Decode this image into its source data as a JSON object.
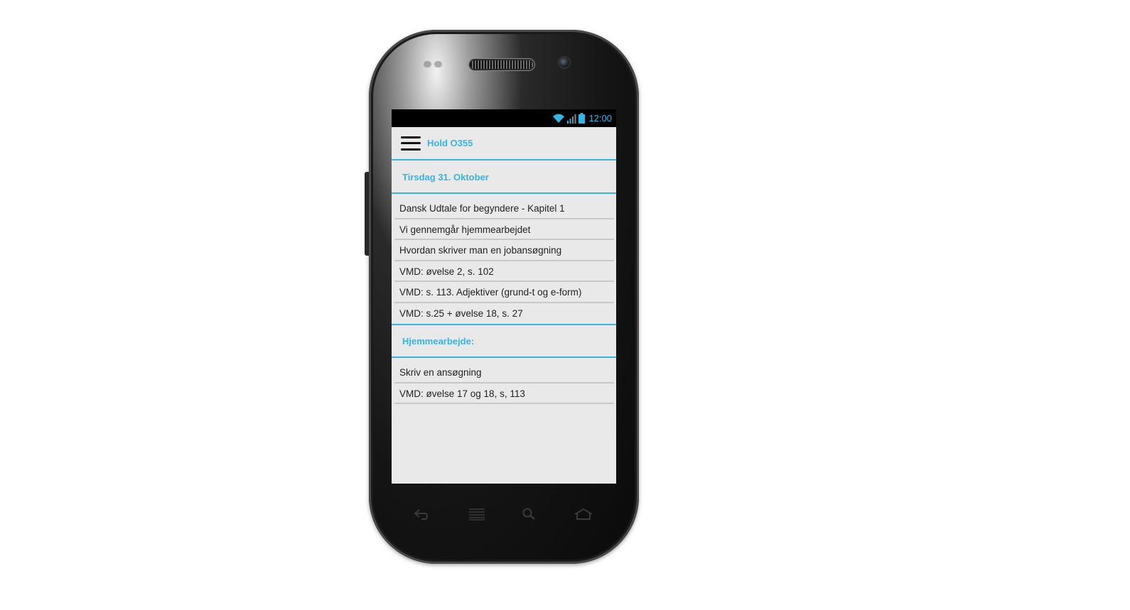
{
  "status": {
    "time": "12:00"
  },
  "header": {
    "title": "Hold O355"
  },
  "date_section": {
    "title": "Tirsdag 31. Oktober"
  },
  "lessons": [
    "Dansk Udtale for begyndere - Kapitel 1",
    "Vi gennemgår hjemmearbejdet",
    "Hvordan skriver man en jobansøgning",
    "VMD: øvelse 2, s. 102",
    "VMD: s. 113. Adjektiver (grund-t og e-form)",
    "VMD: s.25 + øvelse 18, s. 27"
  ],
  "homework_section": {
    "title": "Hjemmearbejde:"
  },
  "homework": [
    "Skriv en ansøgning",
    "VMD: øvelse 17 og 18, s, 113"
  ],
  "colors": {
    "accent": "#33b5e5",
    "screen_bg": "#e9e9e9"
  },
  "icons": [
    "wifi-icon",
    "signal-icon",
    "battery-icon",
    "menu-icon",
    "back-icon",
    "recent-apps-icon",
    "search-icon",
    "home-icon"
  ]
}
